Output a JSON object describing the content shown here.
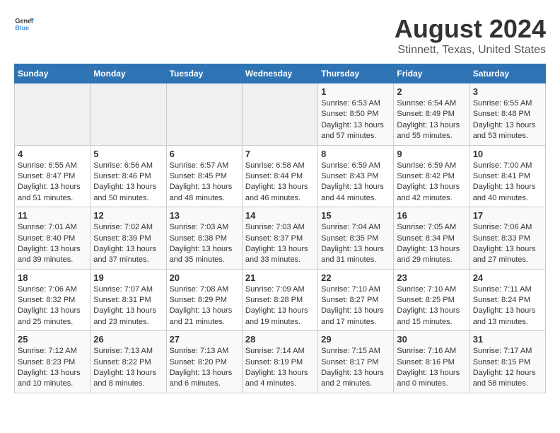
{
  "header": {
    "logo_general": "General",
    "logo_blue": "Blue",
    "title": "August 2024",
    "subtitle": "Stinnett, Texas, United States"
  },
  "weekdays": [
    "Sunday",
    "Monday",
    "Tuesday",
    "Wednesday",
    "Thursday",
    "Friday",
    "Saturday"
  ],
  "weeks": [
    [
      {
        "day": "",
        "info": ""
      },
      {
        "day": "",
        "info": ""
      },
      {
        "day": "",
        "info": ""
      },
      {
        "day": "",
        "info": ""
      },
      {
        "day": "1",
        "info": "Sunrise: 6:53 AM\nSunset: 8:50 PM\nDaylight: 13 hours and 57 minutes."
      },
      {
        "day": "2",
        "info": "Sunrise: 6:54 AM\nSunset: 8:49 PM\nDaylight: 13 hours and 55 minutes."
      },
      {
        "day": "3",
        "info": "Sunrise: 6:55 AM\nSunset: 8:48 PM\nDaylight: 13 hours and 53 minutes."
      }
    ],
    [
      {
        "day": "4",
        "info": "Sunrise: 6:55 AM\nSunset: 8:47 PM\nDaylight: 13 hours and 51 minutes."
      },
      {
        "day": "5",
        "info": "Sunrise: 6:56 AM\nSunset: 8:46 PM\nDaylight: 13 hours and 50 minutes."
      },
      {
        "day": "6",
        "info": "Sunrise: 6:57 AM\nSunset: 8:45 PM\nDaylight: 13 hours and 48 minutes."
      },
      {
        "day": "7",
        "info": "Sunrise: 6:58 AM\nSunset: 8:44 PM\nDaylight: 13 hours and 46 minutes."
      },
      {
        "day": "8",
        "info": "Sunrise: 6:59 AM\nSunset: 8:43 PM\nDaylight: 13 hours and 44 minutes."
      },
      {
        "day": "9",
        "info": "Sunrise: 6:59 AM\nSunset: 8:42 PM\nDaylight: 13 hours and 42 minutes."
      },
      {
        "day": "10",
        "info": "Sunrise: 7:00 AM\nSunset: 8:41 PM\nDaylight: 13 hours and 40 minutes."
      }
    ],
    [
      {
        "day": "11",
        "info": "Sunrise: 7:01 AM\nSunset: 8:40 PM\nDaylight: 13 hours and 39 minutes."
      },
      {
        "day": "12",
        "info": "Sunrise: 7:02 AM\nSunset: 8:39 PM\nDaylight: 13 hours and 37 minutes."
      },
      {
        "day": "13",
        "info": "Sunrise: 7:03 AM\nSunset: 8:38 PM\nDaylight: 13 hours and 35 minutes."
      },
      {
        "day": "14",
        "info": "Sunrise: 7:03 AM\nSunset: 8:37 PM\nDaylight: 13 hours and 33 minutes."
      },
      {
        "day": "15",
        "info": "Sunrise: 7:04 AM\nSunset: 8:35 PM\nDaylight: 13 hours and 31 minutes."
      },
      {
        "day": "16",
        "info": "Sunrise: 7:05 AM\nSunset: 8:34 PM\nDaylight: 13 hours and 29 minutes."
      },
      {
        "day": "17",
        "info": "Sunrise: 7:06 AM\nSunset: 8:33 PM\nDaylight: 13 hours and 27 minutes."
      }
    ],
    [
      {
        "day": "18",
        "info": "Sunrise: 7:06 AM\nSunset: 8:32 PM\nDaylight: 13 hours and 25 minutes."
      },
      {
        "day": "19",
        "info": "Sunrise: 7:07 AM\nSunset: 8:31 PM\nDaylight: 13 hours and 23 minutes."
      },
      {
        "day": "20",
        "info": "Sunrise: 7:08 AM\nSunset: 8:29 PM\nDaylight: 13 hours and 21 minutes."
      },
      {
        "day": "21",
        "info": "Sunrise: 7:09 AM\nSunset: 8:28 PM\nDaylight: 13 hours and 19 minutes."
      },
      {
        "day": "22",
        "info": "Sunrise: 7:10 AM\nSunset: 8:27 PM\nDaylight: 13 hours and 17 minutes."
      },
      {
        "day": "23",
        "info": "Sunrise: 7:10 AM\nSunset: 8:25 PM\nDaylight: 13 hours and 15 minutes."
      },
      {
        "day": "24",
        "info": "Sunrise: 7:11 AM\nSunset: 8:24 PM\nDaylight: 13 hours and 13 minutes."
      }
    ],
    [
      {
        "day": "25",
        "info": "Sunrise: 7:12 AM\nSunset: 8:23 PM\nDaylight: 13 hours and 10 minutes."
      },
      {
        "day": "26",
        "info": "Sunrise: 7:13 AM\nSunset: 8:22 PM\nDaylight: 13 hours and 8 minutes."
      },
      {
        "day": "27",
        "info": "Sunrise: 7:13 AM\nSunset: 8:20 PM\nDaylight: 13 hours and 6 minutes."
      },
      {
        "day": "28",
        "info": "Sunrise: 7:14 AM\nSunset: 8:19 PM\nDaylight: 13 hours and 4 minutes."
      },
      {
        "day": "29",
        "info": "Sunrise: 7:15 AM\nSunset: 8:17 PM\nDaylight: 13 hours and 2 minutes."
      },
      {
        "day": "30",
        "info": "Sunrise: 7:16 AM\nSunset: 8:16 PM\nDaylight: 13 hours and 0 minutes."
      },
      {
        "day": "31",
        "info": "Sunrise: 7:17 AM\nSunset: 8:15 PM\nDaylight: 12 hours and 58 minutes."
      }
    ]
  ]
}
